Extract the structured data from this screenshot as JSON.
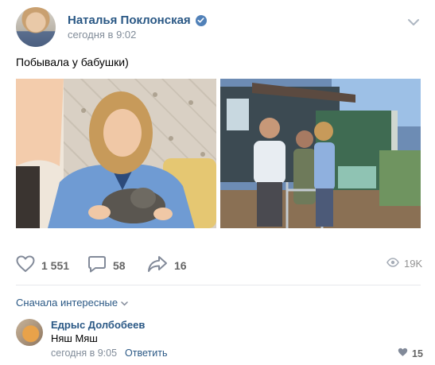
{
  "post": {
    "author": "Наталья Поклонская",
    "date": "сегодня в 9:02",
    "text": "Побывала у бабушки)"
  },
  "actions": {
    "likes": "1 551",
    "comments": "58",
    "shares": "16",
    "views": "19K"
  },
  "comments_section": {
    "sort_label": "Сначала интересные",
    "items": [
      {
        "author": "Едрыс Долбобеев",
        "text": "Няш Мяш",
        "date": "сегодня в 9:05",
        "reply_label": "Ответить",
        "likes": "15"
      }
    ]
  },
  "colors": {
    "link": "#2a5885",
    "muted": "#818c99",
    "icon": "#828a99",
    "verified": "#5181b8"
  },
  "icons": [
    "verified-badge-icon",
    "chevron-down-icon",
    "heart-icon",
    "comment-icon",
    "share-arrow-icon",
    "eye-icon"
  ]
}
